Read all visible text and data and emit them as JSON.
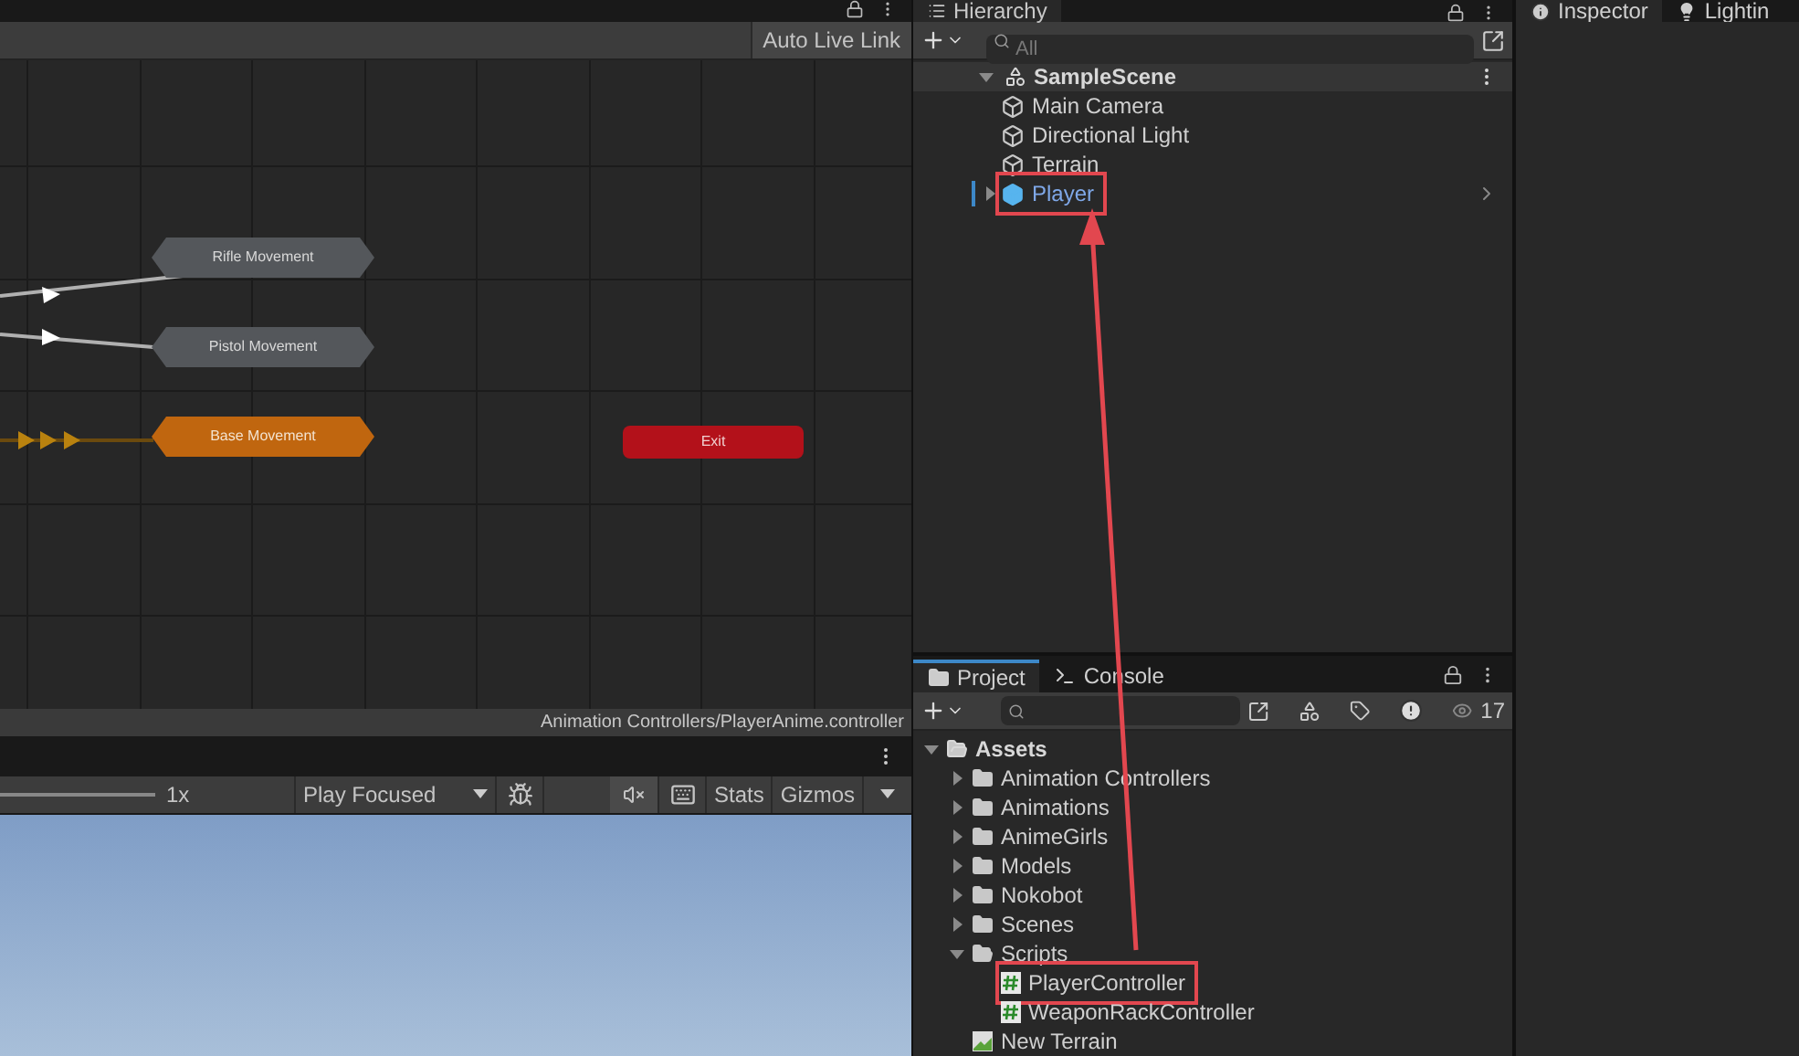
{
  "animator": {
    "toolbar_button": "Auto Live Link",
    "nodes": [
      {
        "label": "Rifle Movement",
        "kind": "state"
      },
      {
        "label": "Pistol Movement",
        "kind": "state"
      },
      {
        "label": "Base Movement",
        "kind": "default"
      },
      {
        "label": "Exit",
        "kind": "exit"
      }
    ],
    "path": "Animation Controllers/PlayerAnime.controller"
  },
  "game_view": {
    "scale": "1x",
    "play_mode": "Play Focused",
    "stats": "Stats",
    "gizmos": "Gizmos"
  },
  "hierarchy": {
    "title": "Hierarchy",
    "search_placeholder": "All",
    "scene": {
      "name": "SampleScene",
      "expanded": true,
      "children": [
        {
          "name": "Main Camera",
          "kind": "object"
        },
        {
          "name": "Directional Light",
          "kind": "object"
        },
        {
          "name": "Terrain",
          "kind": "object"
        },
        {
          "name": "Player",
          "kind": "prefab",
          "expanded": false,
          "highlighted": true
        }
      ]
    }
  },
  "project": {
    "tabs": [
      {
        "label": "Project",
        "selected": true
      },
      {
        "label": "Console",
        "selected": false
      }
    ],
    "hidden_count": "17",
    "root": {
      "name": "Assets",
      "expanded": true,
      "children": [
        {
          "name": "Animation Controllers",
          "kind": "folder",
          "expanded": false
        },
        {
          "name": "Animations",
          "kind": "folder",
          "expanded": false
        },
        {
          "name": "AnimeGirls",
          "kind": "folder",
          "expanded": false
        },
        {
          "name": "Models",
          "kind": "folder",
          "expanded": false
        },
        {
          "name": "Nokobot",
          "kind": "folder",
          "expanded": false
        },
        {
          "name": "Scenes",
          "kind": "folder",
          "expanded": false
        },
        {
          "name": "Scripts",
          "kind": "folder",
          "expanded": true,
          "children": [
            {
              "name": "PlayerController",
              "kind": "script",
              "highlighted": true
            },
            {
              "name": "WeaponRackController",
              "kind": "script",
              "highlighted": false
            }
          ]
        },
        {
          "name": "New Terrain",
          "kind": "terrain"
        }
      ]
    }
  },
  "inspector": {
    "tabs": [
      {
        "label": "Inspector",
        "selected": true
      },
      {
        "label": "Lightin",
        "selected": false
      }
    ]
  }
}
